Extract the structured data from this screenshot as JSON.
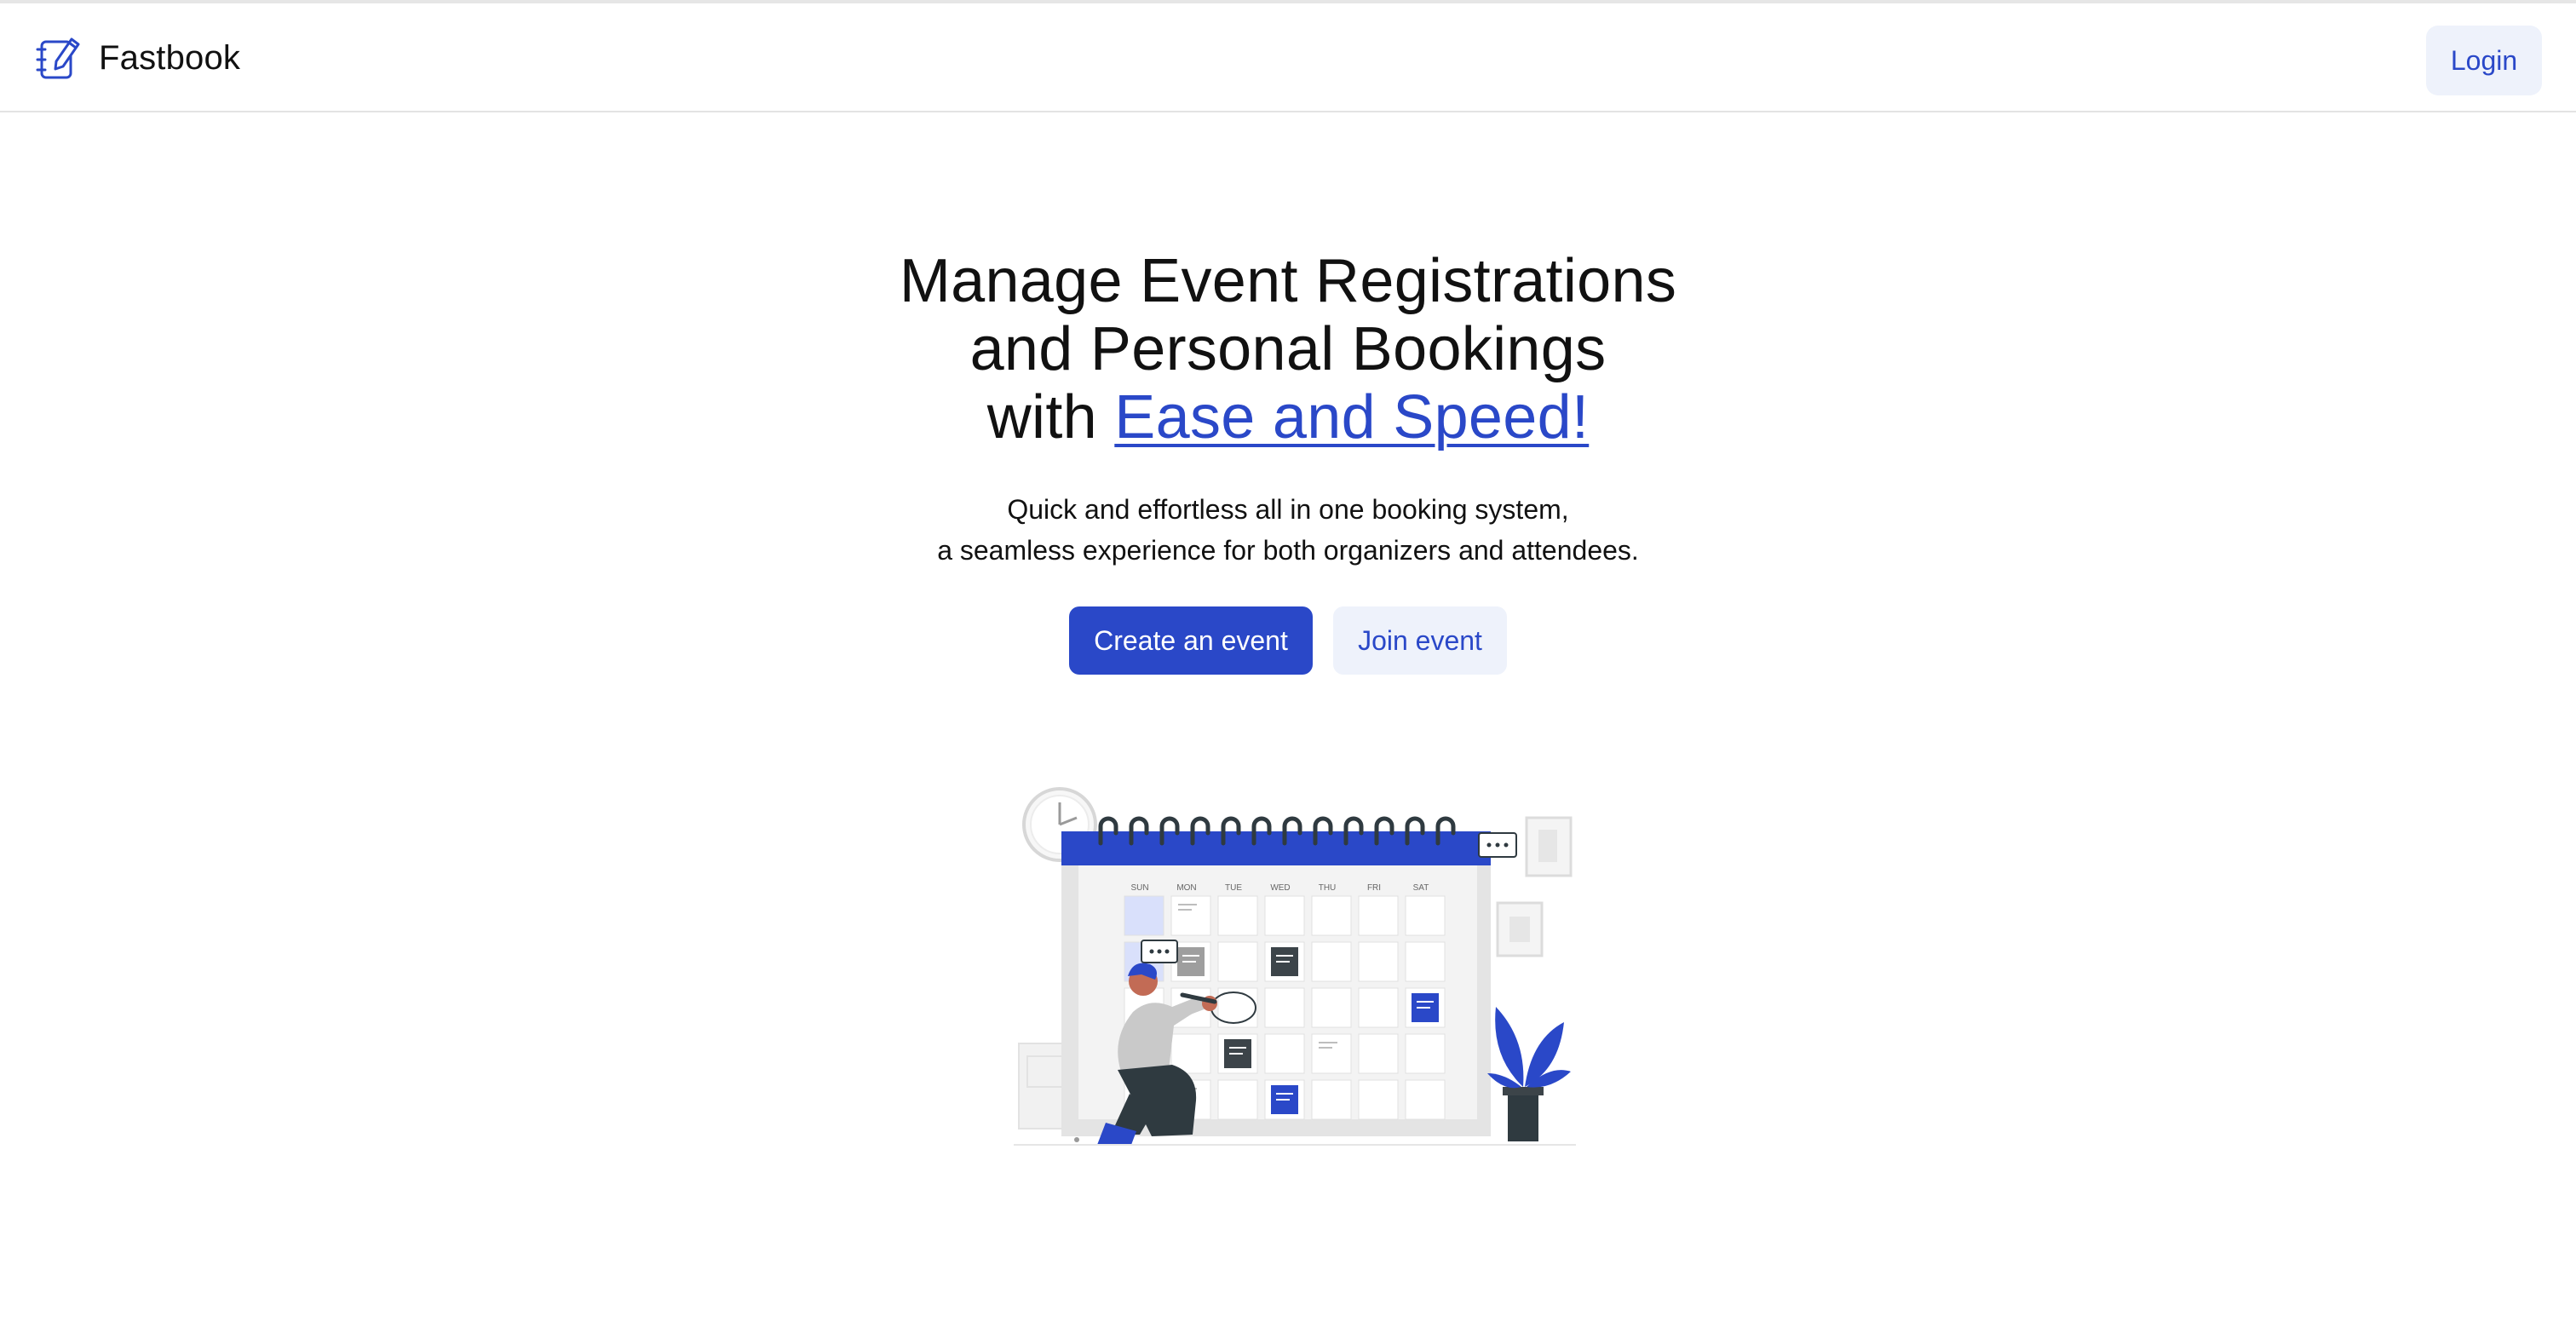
{
  "brand": {
    "name": "Fastbook",
    "icon": "notebook-pen-icon"
  },
  "nav": {
    "login_label": "Login"
  },
  "hero": {
    "title_line1": "Manage Event Registrations",
    "title_line2": "and Personal Bookings",
    "title_line3_prefix": "with ",
    "title_highlight": "Ease and Speed!",
    "subtitle_line1": "Quick and effortless all in one booking system,",
    "subtitle_line2": "a seamless experience for both organizers and attendees."
  },
  "actions": {
    "create_label": "Create an event",
    "join_label": "Join event"
  },
  "illustration": {
    "days": [
      "SUN",
      "MON",
      "TUE",
      "WED",
      "THU",
      "FRI",
      "SAT"
    ]
  },
  "colors": {
    "accent": "#2a48c8",
    "secondary_bg": "#eef2fb",
    "text": "#111111",
    "border": "#e3e3e3"
  }
}
